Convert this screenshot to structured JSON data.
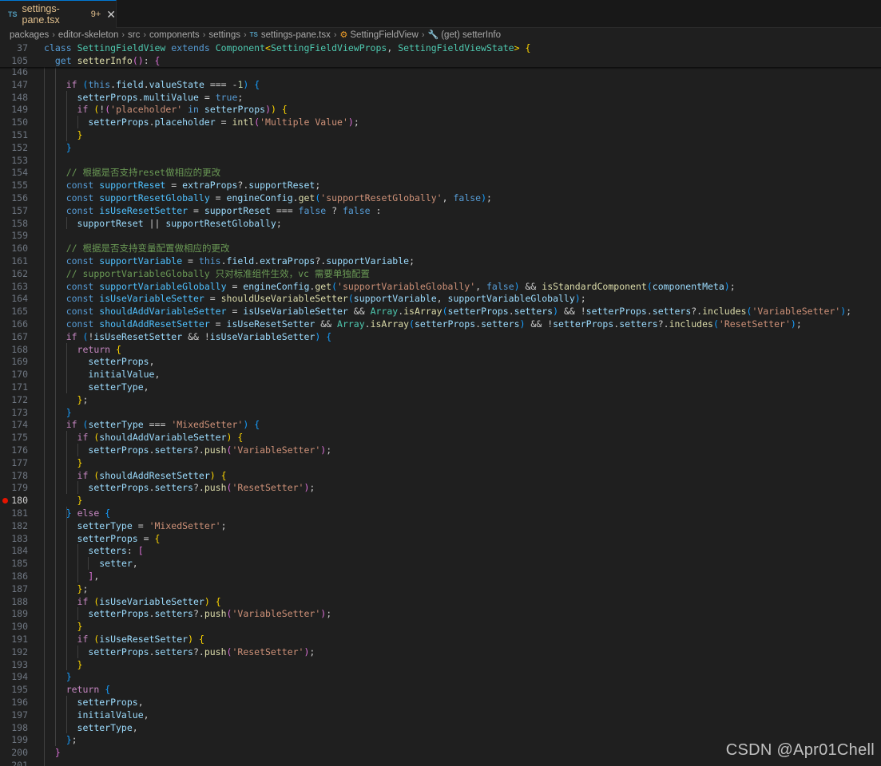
{
  "tab": {
    "filename": "settings-pane.tsx",
    "badge": "9+",
    "lang_icon": "TS",
    "close_icon": "close-icon"
  },
  "breadcrumb": [
    "packages",
    "editor-skeleton",
    "src",
    "components",
    "settings",
    "settings-pane.tsx",
    "SettingFieldView",
    "(get) setterInfo"
  ],
  "sticky_lines": [
    {
      "n": "37",
      "code": "<span class='kw'>class</span> <span class='tp'>SettingFieldView</span> <span class='kw'>extends</span> <span class='tp'>Component</span><span class='b1'>&lt;</span><span class='tp'>SettingFieldViewProps</span>, <span class='tp'>SettingFieldViewState</span><span class='b1'>&gt;</span> <span class='b1'>{</span>"
    },
    {
      "n": "105",
      "code": "  <span class='kw'>get</span> <span class='fn'>setterInfo</span><span class='b2'>()</span>: <span class='b2'>{</span>"
    }
  ],
  "code_lines": [
    {
      "n": "146",
      "code": ""
    },
    {
      "n": "147",
      "code": "    <span class='ctl'>if</span> <span class='b3'>(</span><span class='kw'>this</span>.<span class='vr'>field</span>.<span class='vr'>valueState</span> === -<span class='nm'>1</span><span class='b3'>)</span> <span class='b3'>{</span>"
    },
    {
      "n": "148",
      "code": "      <span class='vr'>setterProps</span>.<span class='vr'>multiValue</span> = <span class='kw'>true</span>;"
    },
    {
      "n": "149",
      "code": "      <span class='ctl'>if</span> <span class='b1'>(</span>!<span class='b2'>(</span><span class='str'>'placeholder'</span> <span class='kw'>in</span> <span class='vr'>setterProps</span><span class='b2'>)</span><span class='b1'>)</span> <span class='b1'>{</span>"
    },
    {
      "n": "150",
      "code": "        <span class='vr'>setterProps</span>.<span class='vr'>placeholder</span> = <span class='fn'>intl</span><span class='b2'>(</span><span class='str'>'Multiple Value'</span><span class='b2'>)</span>;"
    },
    {
      "n": "151",
      "code": "      <span class='b1'>}</span>"
    },
    {
      "n": "152",
      "code": "    <span class='b3'>}</span>"
    },
    {
      "n": "153",
      "code": ""
    },
    {
      "n": "154",
      "code": "    <span class='cm'>// 根据是否支持reset做相应的更改</span>"
    },
    {
      "n": "155",
      "code": "    <span class='kw'>const</span> <span class='cs'>supportReset</span> = <span class='vr'>extraProps</span>?.<span class='vr'>supportReset</span>;"
    },
    {
      "n": "156",
      "code": "    <span class='kw'>const</span> <span class='cs'>supportResetGlobally</span> = <span class='vr'>engineConfig</span>.<span class='fn'>get</span><span class='b3'>(</span><span class='str'>'supportResetGlobally'</span>, <span class='kw'>false</span><span class='b3'>)</span>;"
    },
    {
      "n": "157",
      "code": "    <span class='kw'>const</span> <span class='cs'>isUseResetSetter</span> = <span class='vr'>supportReset</span> === <span class='kw'>false</span> ? <span class='kw'>false</span> :"
    },
    {
      "n": "158",
      "code": "      <span class='vr'>supportReset</span> || <span class='vr'>supportResetGlobally</span>;"
    },
    {
      "n": "159",
      "code": ""
    },
    {
      "n": "160",
      "code": "    <span class='cm'>// 根据是否支持变量配置做相应的更改</span>"
    },
    {
      "n": "161",
      "code": "    <span class='kw'>const</span> <span class='cs'>supportVariable</span> = <span class='kw'>this</span>.<span class='vr'>field</span>.<span class='vr'>extraProps</span>?.<span class='vr'>supportVariable</span>;"
    },
    {
      "n": "162",
      "code": "    <span class='cm'>// supportVariableGlobally 只对标准组件生效，vc 需要单独配置</span>"
    },
    {
      "n": "163",
      "code": "    <span class='kw'>const</span> <span class='cs'>supportVariableGlobally</span> = <span class='vr'>engineConfig</span>.<span class='fn'>get</span><span class='b3'>(</span><span class='str'>'supportVariableGlobally'</span>, <span class='kw'>false</span><span class='b3'>)</span> &amp;&amp; <span class='fn'>isStandardComponent</span><span class='b3'>(</span><span class='vr'>componentMeta</span><span class='b3'>)</span>;"
    },
    {
      "n": "164",
      "code": "    <span class='kw'>const</span> <span class='cs'>isUseVariableSetter</span> = <span class='fn'>shouldUseVariableSetter</span><span class='b3'>(</span><span class='vr'>supportVariable</span>, <span class='vr'>supportVariableGlobally</span><span class='b3'>)</span>;"
    },
    {
      "n": "165",
      "code": "    <span class='kw'>const</span> <span class='cs'>shouldAddVariableSetter</span> = <span class='vr'>isUseVariableSetter</span> &amp;&amp; <span class='tp'>Array</span>.<span class='fn'>isArray</span><span class='b3'>(</span><span class='vr'>setterProps</span>.<span class='vr'>setters</span><span class='b3'>)</span> &amp;&amp; !<span class='vr'>setterProps</span>.<span class='vr'>setters</span>?.<span class='fn'>includes</span><span class='b3'>(</span><span class='str'>'VariableSetter'</span><span class='b3'>)</span>;"
    },
    {
      "n": "166",
      "code": "    <span class='kw'>const</span> <span class='cs'>shouldAddResetSetter</span> = <span class='vr'>isUseResetSetter</span> &amp;&amp; <span class='tp'>Array</span>.<span class='fn'>isArray</span><span class='b3'>(</span><span class='vr'>setterProps</span>.<span class='vr'>setters</span><span class='b3'>)</span> &amp;&amp; !<span class='vr'>setterProps</span>.<span class='vr'>setters</span>?.<span class='fn'>includes</span><span class='b3'>(</span><span class='str'>'ResetSetter'</span><span class='b3'>)</span>;"
    },
    {
      "n": "167",
      "code": "    <span class='ctl'>if</span> <span class='b3'>(</span>!<span class='vr'>isUseResetSetter</span> &amp;&amp; !<span class='vr'>isUseVariableSetter</span><span class='b3'>)</span> <span class='b3'>{</span>"
    },
    {
      "n": "168",
      "code": "      <span class='ctl'>return</span> <span class='b1'>{</span>"
    },
    {
      "n": "169",
      "code": "        <span class='vr'>setterProps</span>,"
    },
    {
      "n": "170",
      "code": "        <span class='vr'>initialValue</span>,"
    },
    {
      "n": "171",
      "code": "        <span class='vr'>setterType</span>,"
    },
    {
      "n": "172",
      "code": "      <span class='b1'>}</span>;"
    },
    {
      "n": "173",
      "code": "    <span class='b3'>}</span>"
    },
    {
      "n": "174",
      "code": "    <span class='ctl'>if</span> <span class='b3'>(</span><span class='vr'>setterType</span> === <span class='str'>'MixedSetter'</span><span class='b3'>)</span> <span class='b3'>{</span>"
    },
    {
      "n": "175",
      "code": "      <span class='ctl'>if</span> <span class='b1'>(</span><span class='vr'>shouldAddVariableSetter</span><span class='b1'>)</span> <span class='b1'>{</span>"
    },
    {
      "n": "176",
      "code": "        <span class='vr'>setterProps</span>.<span class='vr'>setters</span>?.<span class='fn'>push</span><span class='b2'>(</span><span class='str'>'VariableSetter'</span><span class='b2'>)</span>;"
    },
    {
      "n": "177",
      "code": "      <span class='b1'>}</span>"
    },
    {
      "n": "178",
      "code": "      <span class='ctl'>if</span> <span class='b1'>(</span><span class='vr'>shouldAddResetSetter</span><span class='b1'>)</span> <span class='b1'>{</span>"
    },
    {
      "n": "179",
      "code": "        <span class='vr'>setterProps</span>.<span class='vr'>setters</span>?.<span class='fn'>push</span><span class='b2'>(</span><span class='str'>'ResetSetter'</span><span class='b2'>)</span>;"
    },
    {
      "n": "180",
      "code": "      <span class='b1'>}</span>",
      "breakpoint": true
    },
    {
      "n": "181",
      "code": "    <span class='b3'>}</span> <span class='ctl'>else</span> <span class='b3'>{</span>"
    },
    {
      "n": "182",
      "code": "      <span class='vr'>setterType</span> = <span class='str'>'MixedSetter'</span>;"
    },
    {
      "n": "183",
      "code": "      <span class='vr'>setterProps</span> = <span class='b1'>{</span>"
    },
    {
      "n": "184",
      "code": "        <span class='vr'>setters</span>: <span class='b2'>[</span>"
    },
    {
      "n": "185",
      "code": "          <span class='vr'>setter</span>,"
    },
    {
      "n": "186",
      "code": "        <span class='b2'>]</span>,"
    },
    {
      "n": "187",
      "code": "      <span class='b1'>}</span>;"
    },
    {
      "n": "188",
      "code": "      <span class='ctl'>if</span> <span class='b1'>(</span><span class='vr'>isUseVariableSetter</span><span class='b1'>)</span> <span class='b1'>{</span>"
    },
    {
      "n": "189",
      "code": "        <span class='vr'>setterProps</span>.<span class='vr'>setters</span>?.<span class='fn'>push</span><span class='b2'>(</span><span class='str'>'VariableSetter'</span><span class='b2'>)</span>;"
    },
    {
      "n": "190",
      "code": "      <span class='b1'>}</span>"
    },
    {
      "n": "191",
      "code": "      <span class='ctl'>if</span> <span class='b1'>(</span><span class='vr'>isUseResetSetter</span><span class='b1'>)</span> <span class='b1'>{</span>"
    },
    {
      "n": "192",
      "code": "        <span class='vr'>setterProps</span>.<span class='vr'>setters</span>?.<span class='fn'>push</span><span class='b2'>(</span><span class='str'>'ResetSetter'</span><span class='b2'>)</span>;"
    },
    {
      "n": "193",
      "code": "      <span class='b1'>}</span>"
    },
    {
      "n": "194",
      "code": "    <span class='b3'>}</span>"
    },
    {
      "n": "195",
      "code": "    <span class='ctl'>return</span> <span class='b3'>{</span>"
    },
    {
      "n": "196",
      "code": "      <span class='vr'>setterProps</span>,"
    },
    {
      "n": "197",
      "code": "      <span class='vr'>initialValue</span>,"
    },
    {
      "n": "198",
      "code": "      <span class='vr'>setterType</span>,"
    },
    {
      "n": "199",
      "code": "    <span class='b3'>}</span>;"
    },
    {
      "n": "200",
      "code": "  <span class='b2'>}</span>"
    },
    {
      "n": "201",
      "code": ""
    }
  ],
  "watermark": "CSDN @Apr01Chell",
  "colors": {
    "editor_bg": "#1f1f1f",
    "keyword": "#569cd6",
    "control": "#c586c0",
    "string": "#ce9178",
    "function": "#dcdcaa",
    "variable": "#9cdcfe",
    "type": "#4ec9b0",
    "comment": "#6a9955",
    "breakpoint": "#e51400"
  }
}
